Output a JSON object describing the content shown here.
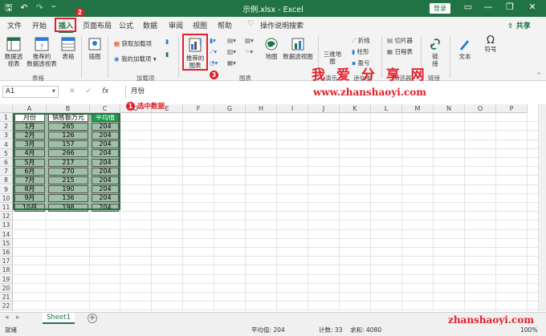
{
  "titlebar": {
    "title": "示例.xlsx - Excel",
    "login": "登录",
    "qat_save": "🖫",
    "qat_undo": "↶",
    "qat_redo": "↷",
    "qat_more": "⁼",
    "minimize": "—",
    "restore": "❐",
    "close": "✕"
  },
  "tabs": {
    "file": "文件",
    "home": "开始",
    "insert": "插入",
    "page_layout": "页面布局",
    "formulas": "公式",
    "data": "数据",
    "review": "审阅",
    "view": "视图",
    "help": "帮助",
    "tell_me": "操作说明搜索",
    "share": "共享"
  },
  "steps": {
    "s1": "1",
    "s2": "2",
    "s3": "3"
  },
  "ribbon": {
    "pivot_table": "数据透\n视表",
    "recommended_pivot": "推荐的\n数据透视表",
    "table": "表格",
    "illustrations": "插图",
    "get_addins": "获取加载项",
    "my_addins": "我的加载项",
    "recommended_charts": "推荐的\n图表",
    "maps": "地图",
    "pivot_chart": "数据透视图",
    "3d_map": "三维地\n图",
    "line": "折线",
    "column": "柱形",
    "winloss": "盈亏",
    "slicer": "切片器",
    "timeline": "日程表",
    "link": "链\n接",
    "text": "文本",
    "symbols": "符号",
    "group_tables": "表格",
    "group_addins": "加载项",
    "group_charts": "图表",
    "group_tours": "演示",
    "group_sparklines": "迷你图",
    "group_filters": "筛选器",
    "group_links": "链接"
  },
  "formula_bar": {
    "name_box": "A1",
    "cancel": "✕",
    "enter": "✓",
    "fx": "fx",
    "value": "月份"
  },
  "columns": [
    "A",
    "B",
    "C",
    "D",
    "E",
    "F",
    "G",
    "H",
    "I",
    "J",
    "K",
    "L",
    "M",
    "N",
    "O",
    "P"
  ],
  "rows": [
    "1",
    "2",
    "3",
    "4",
    "5",
    "6",
    "7",
    "8",
    "9",
    "10",
    "11",
    "12",
    "13",
    "14",
    "15",
    "16",
    "17",
    "18",
    "19",
    "20",
    "21",
    "22"
  ],
  "table": {
    "headers": [
      "月份",
      "销售额万元",
      "平均值"
    ],
    "rows": [
      [
        "1月",
        "265",
        "204"
      ],
      [
        "2月",
        "126",
        "204"
      ],
      [
        "3月",
        "157",
        "204"
      ],
      [
        "4月",
        "266",
        "204"
      ],
      [
        "5月",
        "217",
        "204"
      ],
      [
        "6月",
        "270",
        "204"
      ],
      [
        "7月",
        "215",
        "204"
      ],
      [
        "8月",
        "190",
        "204"
      ],
      [
        "9月",
        "136",
        "204"
      ],
      [
        "10月",
        "198",
        "204"
      ]
    ]
  },
  "annotation": "选中数据",
  "watermark": {
    "title": "我 爱 分 享 网",
    "url": "www.zhanshaoyi.com",
    "bottom": "zhanshaoyi.com"
  },
  "sheet_tab": "Sheet1",
  "add_sheet": "+",
  "status": {
    "ready": "就绪",
    "average": "平均值: 204",
    "count": "计数: 33",
    "sum": "求和: 4080",
    "zoom": "100%"
  },
  "colors": {
    "excel_green": "#217346",
    "annotation_red": "#e0212b",
    "selection_fill": "#9fbfa6",
    "header_highlight": "#1e9c4a"
  }
}
